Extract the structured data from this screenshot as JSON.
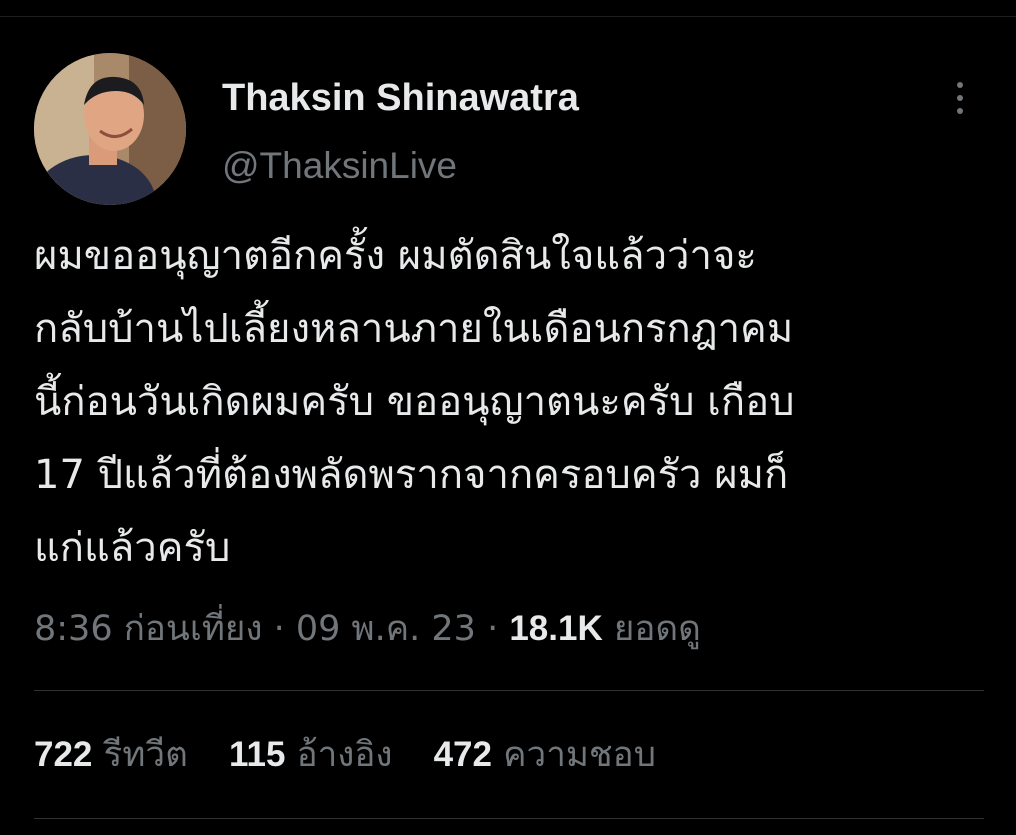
{
  "author": {
    "display_name": "Thaksin Shinawatra",
    "handle": "@ThaksinLive",
    "avatar_icon": "profile-photo"
  },
  "tweet": {
    "text": "ผมขออนุญาตอีกครั้ง ผมตัดสินใจแล้วว่าจะ\nกลับบ้านไปเลี้ยงหลานภายในเดือนกรกฎาคม\nนี้ก่อนวันเกิดผมครับ ขออนุญาตนะครับ เกือบ\n17 ปีแล้วที่ต้องพลัดพรากจากครอบครัว ผมก็\nแก่แล้วครับ",
    "time": "8:36 ก่อนเที่ยง",
    "separator": " · ",
    "date": "09 พ.ค. 23",
    "views_count": "18.1K",
    "views_label": "ยอดดู"
  },
  "stats": [
    {
      "count": "722",
      "label": "รีทวีต"
    },
    {
      "count": "115",
      "label": "อ้างอิง"
    },
    {
      "count": "472",
      "label": "ความชอบ"
    }
  ],
  "colors": {
    "background": "#000000",
    "primary_text": "#e7e9ea",
    "secondary_text": "#71767b",
    "divider": "#2f3336"
  },
  "icons": {
    "more": "more-vertical-icon"
  }
}
